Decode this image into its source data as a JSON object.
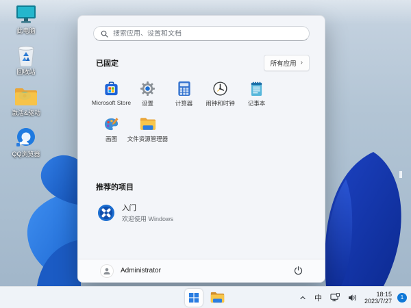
{
  "desktop": {
    "icons": [
      {
        "label": "此电脑",
        "icon": "this-pc"
      },
      {
        "label": "回收站",
        "icon": "recycle-bin"
      },
      {
        "label": "激活&驱动",
        "icon": "folder"
      },
      {
        "label": "QQ浏览器",
        "icon": "qq-browser"
      }
    ]
  },
  "start_menu": {
    "search_placeholder": "搜索应用、设置和文档",
    "pinned_header": "已固定",
    "all_apps_button": "所有应用",
    "all_apps_chevron": "›",
    "pinned_apps": [
      {
        "label": "Microsoft Store",
        "icon": "microsoft-store"
      },
      {
        "label": "设置",
        "icon": "settings-gear"
      },
      {
        "label": "计算器",
        "icon": "calculator"
      },
      {
        "label": "闹钟和时钟",
        "icon": "alarm-clock"
      },
      {
        "label": "记事本",
        "icon": "notepad"
      },
      {
        "label": "画图",
        "icon": "paint-palette"
      },
      {
        "label": "文件资源管理器",
        "icon": "file-explorer-folder"
      }
    ],
    "recommended_header": "推荐的项目",
    "recommended_items": [
      {
        "title": "入门",
        "subtitle": "欢迎使用 Windows",
        "icon": "get-started"
      }
    ],
    "user_name": "Administrator"
  },
  "taskbar": {
    "ime_label": "中",
    "time": "18:15",
    "date": "2023/7/27",
    "notification_count": "1"
  },
  "colors": {
    "accent_blue": "#0b5fd7",
    "badge_blue": "#0f78d7",
    "bloom_dark_blue": "#12339f",
    "bloom_bright_blue": "#2b7de1",
    "folder_yellow": "#f6c244"
  }
}
